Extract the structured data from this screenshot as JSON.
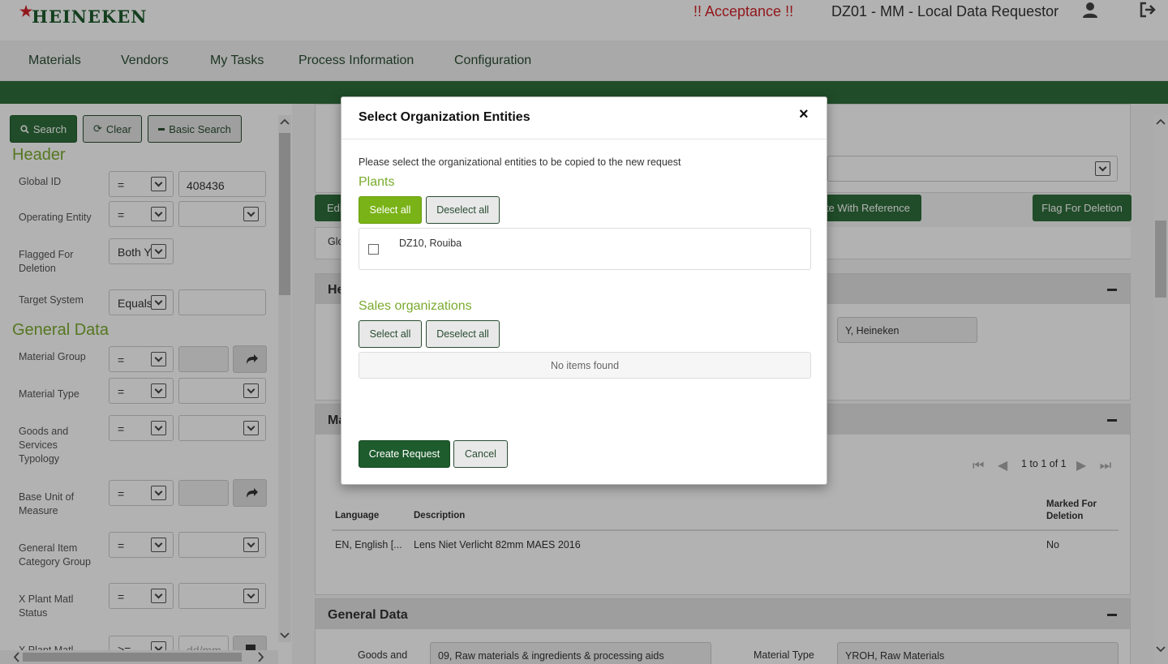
{
  "header": {
    "logo": "HEINEKEN",
    "environment": "!! Acceptance !!",
    "role": "DZ01 - MM - Local Data Requestor"
  },
  "nav": {
    "items": [
      "Materials",
      "Vendors",
      "My Tasks",
      "Process Information",
      "Configuration"
    ]
  },
  "sidebar": {
    "buttons": {
      "search": "Search",
      "clear": "Clear",
      "basic_search": "Basic Search"
    },
    "sections": {
      "header": "Header",
      "general": "General Data"
    },
    "fields": {
      "global_id": {
        "label": "Global ID",
        "op": "=",
        "value": "408436"
      },
      "operating_entity": {
        "label": "Operating Entity",
        "op": "="
      },
      "flagged": {
        "label1": "Flagged For",
        "label2": "Deletion",
        "value": "Both Y"
      },
      "target_system": {
        "label": "Target System",
        "op": "Equals"
      },
      "material_group": {
        "label": "Material Group",
        "op": "="
      },
      "material_type": {
        "label": "Material Type",
        "op": "="
      },
      "goods": {
        "label1": "Goods and",
        "label2": "Services",
        "label3": "Typology",
        "op": "="
      },
      "base_unit": {
        "label1": "Base Unit of",
        "label2": "Measure",
        "op": "="
      },
      "item_cat": {
        "label1": "General Item",
        "label2": "Category Group",
        "op": "="
      },
      "xplant": {
        "label1": "X Plant Matl",
        "label2": "Status",
        "op": "="
      },
      "xplant2": {
        "label": "X Plant Matl",
        "op": ">=",
        "placeholder": "dd/mm"
      }
    }
  },
  "main": {
    "buttons": {
      "edit": "Edi",
      "create_ref": "ate With Reference",
      "flag_delete": "Flag For Deletion"
    },
    "tab": "Glo",
    "panels": {
      "header": "He",
      "materials": "Ma",
      "general": "General Data"
    },
    "owner_field": "Y, Heineken",
    "pagination": "1 to 1 of 1",
    "table": {
      "columns": {
        "language": "Language",
        "description": "Description",
        "marked1": "Marked For",
        "marked2": "Deletion"
      },
      "row": {
        "language": "EN, English [...",
        "description": "Lens Niet Verlicht 82mm MAES 2016",
        "marked": "No"
      }
    },
    "general_fields": {
      "goods_label": "Goods and",
      "goods_value": "09, Raw materials & ingredients & processing aids",
      "type_label": "Material Type",
      "type_value": "YROH, Raw Materials"
    }
  },
  "modal": {
    "title": "Select Organization Entities",
    "close": "×",
    "instruction": "Please select the organizational entities to be copied to the new request",
    "plants": {
      "title": "Plants",
      "select_all": "Select all",
      "deselect_all": "Deselect all",
      "items": [
        "DZ10, Rouiba"
      ]
    },
    "sales": {
      "title": "Sales organizations",
      "select_all": "Select all",
      "deselect_all": "Deselect all",
      "empty": "No items found"
    },
    "buttons": {
      "create": "Create Request",
      "cancel": "Cancel"
    }
  },
  "colors": {
    "brand_green": "#2f6e3b",
    "accent_green": "#7ab317",
    "alert_red": "#d2232a"
  }
}
